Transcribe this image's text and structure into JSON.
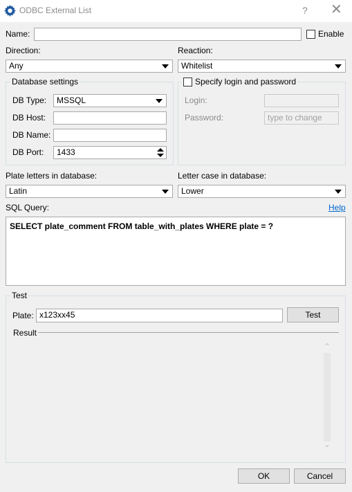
{
  "window": {
    "title": "ODBC External List",
    "help_glyph": "?",
    "close_glyph": "✕"
  },
  "name": {
    "label": "Name:",
    "value": ""
  },
  "enable": {
    "label": "Enable",
    "checked": false
  },
  "direction": {
    "label": "Direction:",
    "value": "Any"
  },
  "reaction": {
    "label": "Reaction:",
    "value": "Whitelist"
  },
  "database_settings": {
    "title": "Database settings",
    "db_type": {
      "label": "DB Type:",
      "value": "MSSQL"
    },
    "db_host": {
      "label": "DB Host:",
      "value": ""
    },
    "db_name": {
      "label": "DB Name:",
      "value": ""
    },
    "db_port": {
      "label": "DB Port:",
      "value": "1433"
    }
  },
  "credentials": {
    "title": "Specify login and password",
    "checked": false,
    "login": {
      "label": "Login:",
      "value": ""
    },
    "password": {
      "label": "Password:",
      "placeholder": "type to change"
    }
  },
  "plate_letters": {
    "label": "Plate letters in database:",
    "value": "Latin"
  },
  "letter_case": {
    "label": "Letter case in database:",
    "value": "Lower"
  },
  "sql": {
    "label": "SQL Query:",
    "help_link": "Help",
    "query": "SELECT plate_comment FROM table_with_plates WHERE plate = ?"
  },
  "test": {
    "title": "Test",
    "plate_label": "Plate:",
    "plate_value": "x123xx45",
    "test_button": "Test",
    "result_label": "Result",
    "scroll_up_glyph": "⌃",
    "scroll_down_glyph": "⌄"
  },
  "footer": {
    "ok": "OK",
    "cancel": "Cancel"
  }
}
